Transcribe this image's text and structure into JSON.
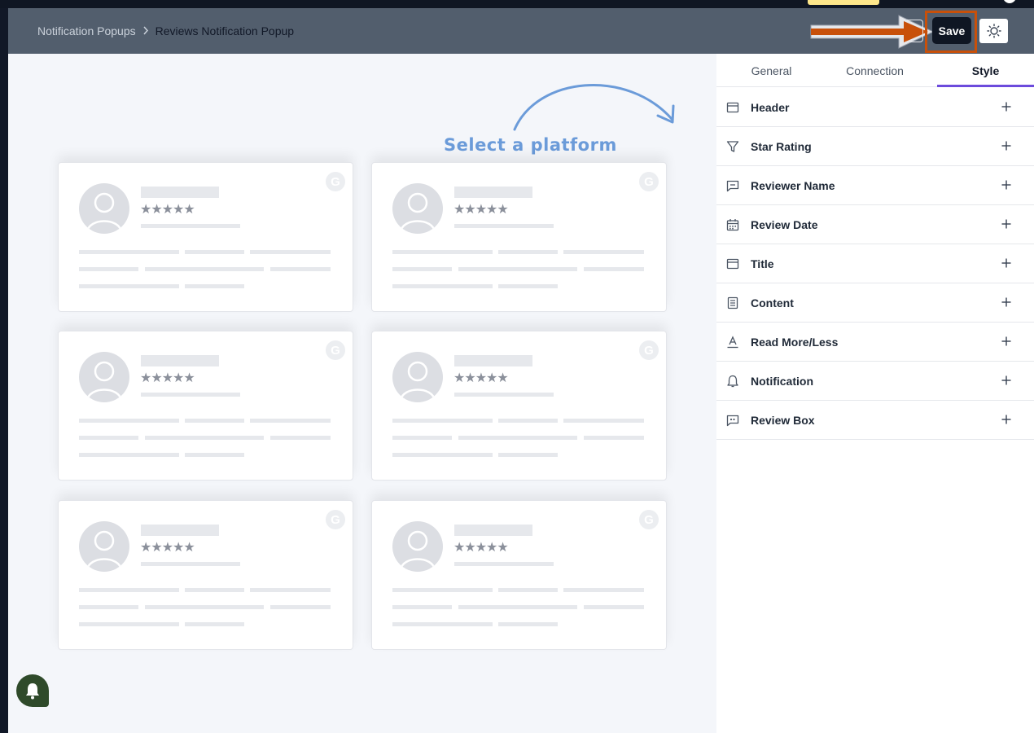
{
  "breadcrumb": {
    "parent": "Notification Popups",
    "separator": ">",
    "current": "Reviews Notification Popup"
  },
  "toolbar": {
    "save_label": "Save",
    "theme_icon": "sun-icon"
  },
  "canvas": {
    "hint_text": "Select a platform",
    "cards": [
      {
        "stars": "★★★★★",
        "platform_letter": "G"
      },
      {
        "stars": "★★★★★",
        "platform_letter": "G"
      },
      {
        "stars": "★★★★★",
        "platform_letter": "G"
      },
      {
        "stars": "★★★★★",
        "platform_letter": "G"
      },
      {
        "stars": "★★★★★",
        "platform_letter": "G"
      },
      {
        "stars": "★★★★★",
        "platform_letter": "G"
      }
    ]
  },
  "panel": {
    "tabs": [
      {
        "label": "General",
        "active": false
      },
      {
        "label": "Connection",
        "active": false
      },
      {
        "label": "Style",
        "active": true
      }
    ],
    "sections": [
      {
        "label": "Header",
        "icon": "layout-header-icon"
      },
      {
        "label": "Star Rating",
        "icon": "filter-icon"
      },
      {
        "label": "Reviewer Name",
        "icon": "message-square-icon"
      },
      {
        "label": "Review Date",
        "icon": "calendar-icon"
      },
      {
        "label": "Title",
        "icon": "layout-header-icon"
      },
      {
        "label": "Content",
        "icon": "document-icon"
      },
      {
        "label": "Read More/Less",
        "icon": "text-underline-icon"
      },
      {
        "label": "Notification",
        "icon": "bell-icon"
      },
      {
        "label": "Review Box",
        "icon": "message-quote-icon"
      }
    ]
  },
  "colors": {
    "header_bg": "#525e6d",
    "accent": "#6c4bdc",
    "highlight": "#c8500a",
    "hint": "#6b9bd9"
  }
}
